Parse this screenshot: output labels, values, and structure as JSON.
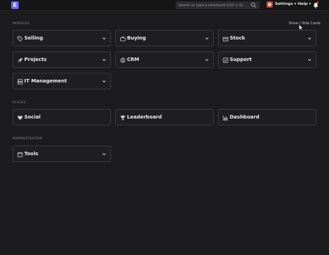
{
  "navbar": {
    "logo_letter": "E",
    "search_placeholder": "Search or type a command (Ctrl + G)",
    "settings_label": "Settings ▾",
    "help_label": "Help ▾"
  },
  "workspace": {
    "toggle_cards_label": "Show / Hide Cards",
    "sections": {
      "modules": {
        "label": "MODULES",
        "cards": [
          {
            "label": "Selling",
            "icon": "tag-icon"
          },
          {
            "label": "Buying",
            "icon": "briefcase-icon"
          },
          {
            "label": "Stock",
            "icon": "box-icon"
          },
          {
            "label": "Projects",
            "icon": "rocket-icon"
          },
          {
            "label": "CRM",
            "icon": "crm-icon"
          },
          {
            "label": "Support",
            "icon": "check-square-icon"
          },
          {
            "label": "IT Management",
            "icon": "server-icon"
          }
        ]
      },
      "places": {
        "label": "PLACES",
        "cards": [
          {
            "label": "Social",
            "icon": "heart-icon"
          },
          {
            "label": "Leaderboard",
            "icon": "trophy-icon"
          },
          {
            "label": "Dashboard",
            "icon": "bar-chart-icon"
          }
        ]
      },
      "administration": {
        "label": "ADMINISTRATION",
        "cards": [
          {
            "label": "Tools",
            "icon": "calendar-icon"
          }
        ]
      }
    }
  },
  "colors": {
    "background": "#1c1c1e",
    "card_border": "#3a3a3d",
    "brand": "#6c63ff"
  }
}
